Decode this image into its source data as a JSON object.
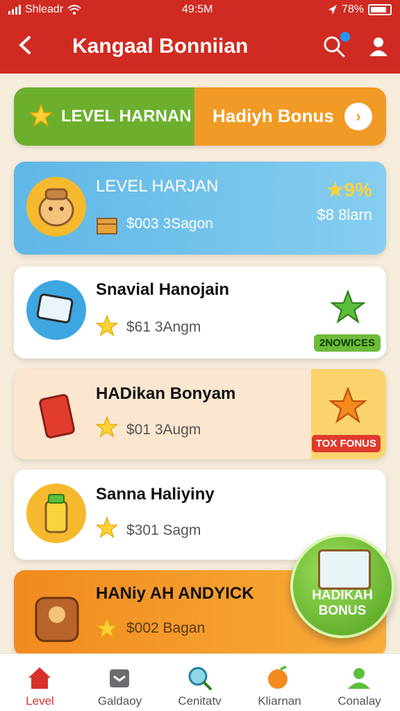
{
  "status": {
    "carrier": "Shleadr",
    "time": "49:5M",
    "battery": "78%"
  },
  "header": {
    "title": "Kangaal Bonniian"
  },
  "banner": {
    "level_label": "LEVEL HARNAN",
    "bonus_label": "Hadiyh Bonus"
  },
  "cards": [
    {
      "title": "LEVEL HARJAN",
      "subtitle": "$003 3Sagon",
      "percent": "9%",
      "amount": "$8 8larn"
    },
    {
      "title": "Snavial Hanojain",
      "subtitle": "$61 3Angm",
      "badge": "2NOWICES"
    },
    {
      "title": "HADikan Bonyam",
      "subtitle": "$01 3Augm",
      "badge": "TOX FONUS"
    },
    {
      "title": "Sanna Haliyiny",
      "subtitle": "$301 Sagm"
    },
    {
      "title": "HANiy AH ANDYICK",
      "subtitle": "$002 Bagan"
    }
  ],
  "fab": {
    "line1": "HADIKAH",
    "line2": "BONUS"
  },
  "nav": [
    {
      "label": "Level",
      "color": "#d6322a"
    },
    {
      "label": "Galdaoy",
      "color": "#555555"
    },
    {
      "label": "Cenitatv",
      "color": "#555555"
    },
    {
      "label": "Kliarnan",
      "color": "#555555"
    },
    {
      "label": "Conalay",
      "color": "#555555"
    }
  ],
  "colors": {
    "primary": "#cf2b22",
    "green": "#6caf2d",
    "orange": "#f19a25",
    "blue": "#5fb7e6"
  },
  "icons": [
    "back-chevron-icon",
    "search-icon",
    "user-icon",
    "star-icon",
    "home-icon"
  ]
}
